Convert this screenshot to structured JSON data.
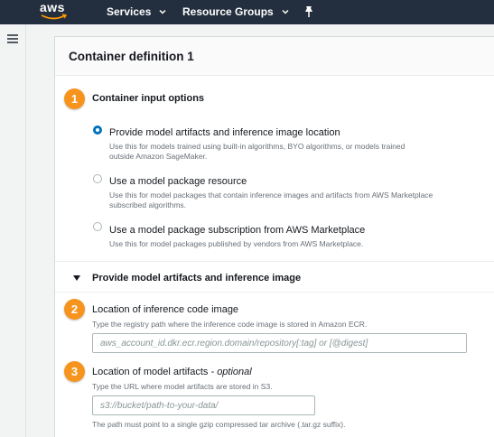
{
  "topnav": {
    "logo": "aws",
    "services_label": "Services",
    "resource_groups_label": "Resource Groups"
  },
  "panel": {
    "title": "Container definition 1"
  },
  "input_options": {
    "step": "1",
    "title": "Container input options",
    "options": [
      {
        "label": "Provide model artifacts and inference image location",
        "description_line1": "Use this for models trained using built-in algorithms, BYO algorithms, or models trained",
        "description_line2": "outside Amazon SageMaker.",
        "selected": true
      },
      {
        "label": "Use a model package resource",
        "description_line1": "Use this for model packages that contain inference images and artifacts from AWS Marketplace",
        "description_line2": "subscribed algorithms.",
        "selected": false
      },
      {
        "label": "Use a model package subscription from AWS Marketplace",
        "description_line1": "Use this for model packages published by vendors from AWS Marketplace.",
        "description_line2": "",
        "selected": false
      }
    ]
  },
  "artifacts_section": {
    "title": "Provide model artifacts and inference image"
  },
  "inference_code": {
    "step": "2",
    "label": "Location of inference code image",
    "description": "Type the registry path where the inference code image is stored in Amazon ECR.",
    "placeholder": "aws_account_id.dkr.ecr.region.domain/repository[:tag] or [@digest]",
    "value": ""
  },
  "model_artifacts": {
    "step": "3",
    "label": "Location of model artifacts",
    "label_optional": "- optional",
    "description": "Type the URL where model artifacts are stored in S3.",
    "placeholder": "s3://bucket/path-to-your-data/",
    "value": "",
    "hint": "The path must point to a single gzip compressed tar archive (.tar.gz suffix)."
  },
  "colors": {
    "nav_bg": "#232f3e",
    "badge": "#f7941d",
    "radio_selected": "#0073bb"
  }
}
